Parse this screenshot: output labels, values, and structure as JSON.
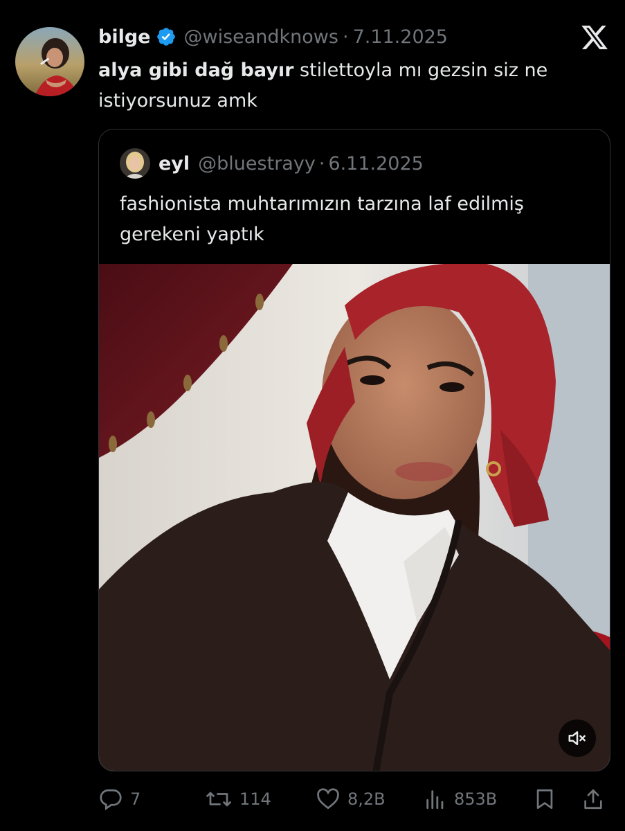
{
  "tweet": {
    "author": {
      "name": "bilge",
      "handle": "@wiseandknows",
      "verified": true
    },
    "separator": "·",
    "date": "7.11.2025",
    "text_bold": "alya gibi dağ bayır",
    "text_rest": " stilettoyla mı gezsin siz ne istiyorsunuz amk"
  },
  "quoted_tweet": {
    "author": {
      "name": "eyl",
      "handle": "@bluestrayy"
    },
    "separator": "·",
    "date": "6.11.2025",
    "text": "fashionista muhtarımızın tarzına laf edilmiş gerekeni yaptık",
    "media": {
      "type": "video",
      "muted": true
    }
  },
  "metrics": {
    "replies": "7",
    "reposts": "114",
    "likes": "8,2B",
    "views": "853B"
  },
  "colors": {
    "background": "#000000",
    "text": "#e7e9ea",
    "secondary": "#71767b",
    "verified": "#1d9bf0",
    "border": "#2f3336"
  },
  "icons": {
    "platform": "x-logo",
    "verified": "verified-badge-icon",
    "reply": "reply-icon",
    "repost": "repost-icon",
    "like": "heart-icon",
    "views": "views-icon",
    "bookmark": "bookmark-icon",
    "share": "share-icon",
    "mute": "muted-speaker-icon"
  }
}
